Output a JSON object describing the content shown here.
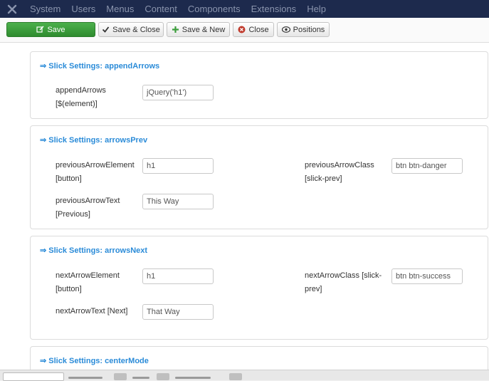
{
  "navbar": {
    "logo_icon": "joomla-logo-icon",
    "items": [
      "System",
      "Users",
      "Menus",
      "Content",
      "Components",
      "Extensions",
      "Help"
    ]
  },
  "toolbar": {
    "save": "Save",
    "save_close": "Save & Close",
    "save_new": "Save & New",
    "close": "Close",
    "positions": "Positions"
  },
  "panels": {
    "append_arrows": {
      "title": "Slick Settings: appendArrows",
      "field_label_1": "appendArrows",
      "field_label_2": "[$(element)]",
      "value": "jQuery('h1')"
    },
    "arrows_prev": {
      "title": "Slick Settings: arrowsPrev",
      "element_label_1": "previousArrowElement",
      "element_label_2": "[button]",
      "element_value": "h1",
      "class_label_1": "previousArrowClass",
      "class_label_2": "[slick-prev]",
      "class_value": "btn btn-danger",
      "text_label_1": "previousArrowText",
      "text_label_2": "[Previous]",
      "text_value": "This Way"
    },
    "arrows_next": {
      "title": "Slick Settings: arrowsNext",
      "element_label_1": "nextArrowElement",
      "element_label_2": "[button]",
      "element_value": "h1",
      "class_label_1": "nextArrowClass [slick-",
      "class_label_2": "prev]",
      "class_value": "btn btn-success",
      "text_label_1": "nextArrowText [Next]",
      "text_value": "That Way"
    },
    "center_mode": {
      "title": "Slick Settings: centerMode"
    }
  },
  "colors": {
    "navbar_bg": "#1d2a4d",
    "title_blue": "#2a8bd8",
    "success_green": "#3c9e3c",
    "danger_red": "#c0392b"
  }
}
